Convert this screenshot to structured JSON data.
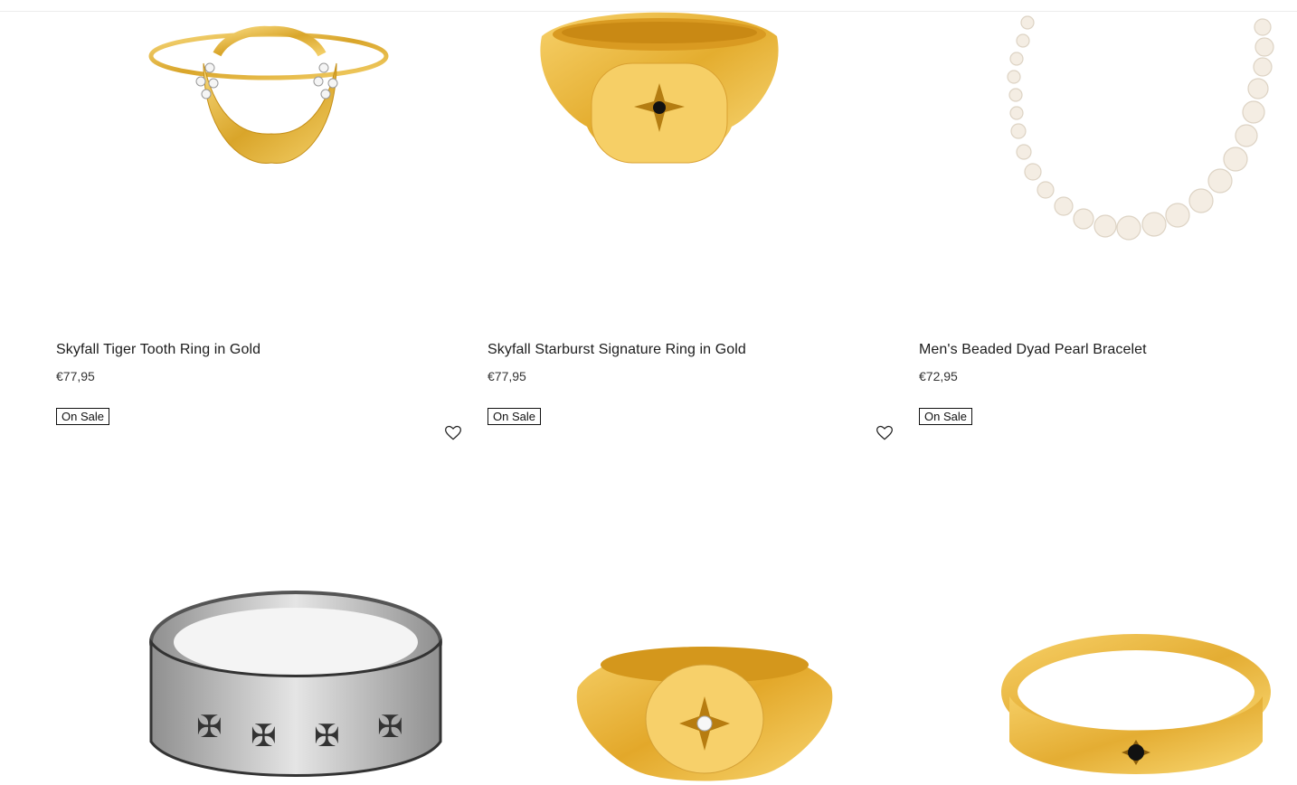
{
  "products": [
    {
      "title": "Skyfall Tiger Tooth Ring in Gold",
      "price": "€77,95",
      "badge": "On Sale",
      "wishlist_icon": "heart-outline-icon"
    },
    {
      "title": "Skyfall Starburst Signature Ring in Gold",
      "price": "€77,95",
      "badge": "On Sale",
      "wishlist_icon": "heart-outline-icon"
    },
    {
      "title": "Men's Beaded Dyad Pearl Bracelet",
      "price": "€72,95",
      "badge": "On Sale"
    },
    {
      "image": "silver-fleur-band-ring"
    },
    {
      "image": "gold-signet-ring-white-stone"
    },
    {
      "image": "gold-band-ring-black-stone"
    }
  ],
  "colors": {
    "gold": "#e6b93a",
    "silver": "#b9b9b9",
    "pearl": "#f3ece1",
    "text": "#1c1c1c"
  }
}
